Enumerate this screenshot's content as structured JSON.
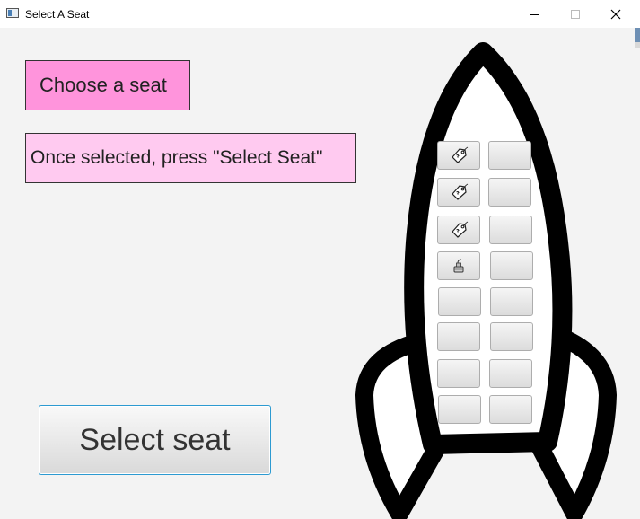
{
  "window": {
    "title": "Select A Seat",
    "controls": [
      "minimize-icon",
      "maximize-icon",
      "close-icon"
    ]
  },
  "labels": {
    "choose": "Choose a seat",
    "hint": "Once selected, press \"Select Seat\""
  },
  "select_button": {
    "label": "Select seat"
  },
  "seat_grid": {
    "rows": [
      [
        "tag-icon",
        ""
      ],
      [
        "tag-icon",
        ""
      ],
      [
        "tag-icon",
        ""
      ],
      [
        "ink-bottle-icon",
        ""
      ],
      [
        "",
        ""
      ],
      [
        "",
        ""
      ],
      [
        "",
        ""
      ],
      [
        "",
        ""
      ]
    ]
  },
  "colors": {
    "choose_bg": "#ff94dc",
    "hint_bg": "#ffcaf0",
    "button_border": "#2c9ad1",
    "background": "#f3f3f3"
  }
}
